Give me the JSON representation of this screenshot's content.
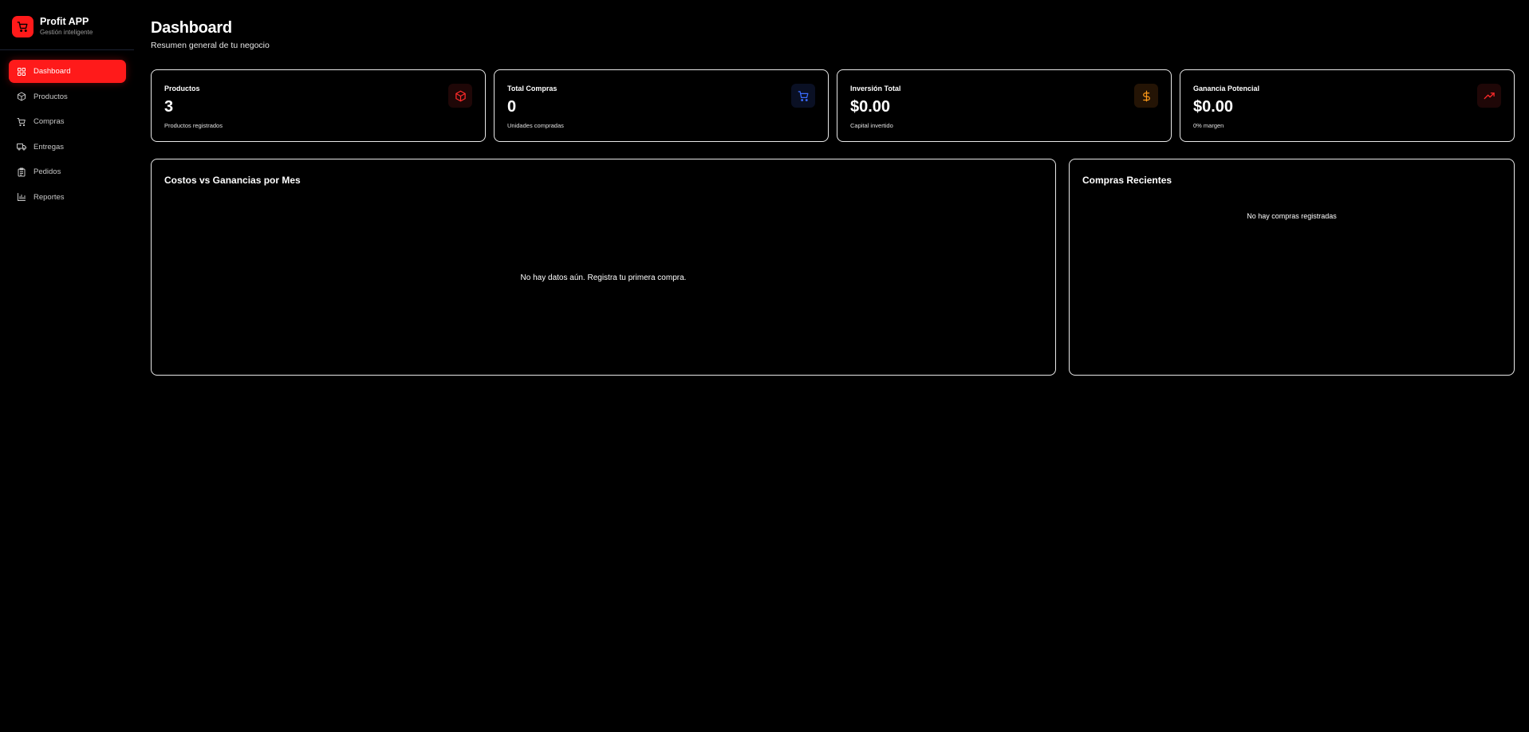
{
  "app": {
    "name": "Profit APP",
    "tagline": "Gestión inteligente",
    "logo_icon": "shopping-cart-icon",
    "brand_color": "#ff1a1a"
  },
  "sidebar": {
    "items": [
      {
        "label": "Dashboard",
        "icon": "dashboard-grid-icon",
        "active": true
      },
      {
        "label": "Productos",
        "icon": "box-icon",
        "active": false
      },
      {
        "label": "Compras",
        "icon": "shopping-cart-icon",
        "active": false
      },
      {
        "label": "Entregas",
        "icon": "truck-icon",
        "active": false
      },
      {
        "label": "Pedidos",
        "icon": "clipboard-icon",
        "active": false
      },
      {
        "label": "Reportes",
        "icon": "bar-chart-icon",
        "active": false
      }
    ]
  },
  "header": {
    "title": "Dashboard",
    "subtitle": "Resumen general de tu negocio"
  },
  "stats": [
    {
      "label": "Productos",
      "value": "3",
      "sub": "Productos registrados",
      "icon": "box-icon",
      "color": "#ff2a2a"
    },
    {
      "label": "Total Compras",
      "value": "0",
      "sub": "Unidades compradas",
      "icon": "shopping-cart-icon",
      "color": "#3b6cff"
    },
    {
      "label": "Inversión Total",
      "value": "$0.00",
      "sub": "Capital invertido",
      "icon": "dollar-icon",
      "color": "#ff9a1a"
    },
    {
      "label": "Ganancia Potencial",
      "value": "$0.00",
      "sub": "0% margen",
      "icon": "trending-up-icon",
      "color": "#ff2a2a"
    }
  ],
  "chart_panel": {
    "title": "Costos vs Ganancias por Mes",
    "empty_text": "No hay datos aún. Registra tu primera compra."
  },
  "recent_panel": {
    "title": "Compras Recientes",
    "empty_text": "No hay compras registradas"
  }
}
